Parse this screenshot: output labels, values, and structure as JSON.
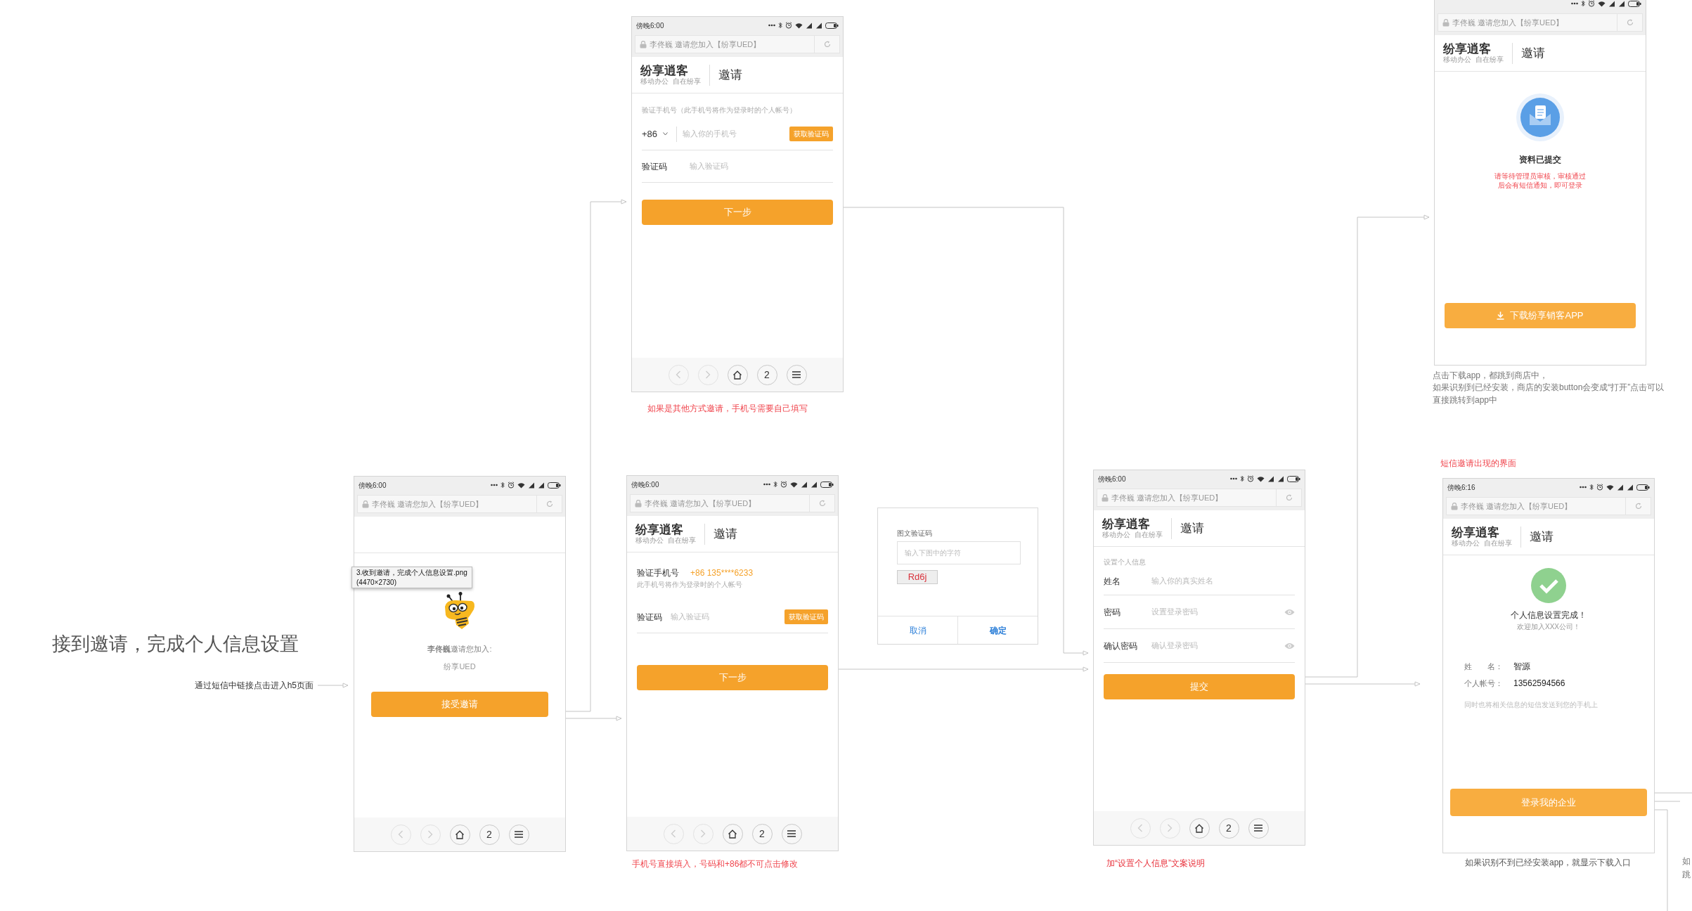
{
  "heading": "接到邀请，完成个人信息设置",
  "entry_note": "通过短信中链接点击进入h5页面",
  "screens": [
    {
      "kind": "phone_input",
      "status_time": "傍晚6:00",
      "address": "李佟巍 邀请您加入【纷享UED】",
      "logo": "纷享逍客",
      "tagline": "移动办公  自在纷享",
      "page_title": "邀请",
      "hint": "验证手机号（此手机号将作为登录时的个人帐号）",
      "country_code": "+86",
      "phone_placeholder": "输入你的手机号",
      "code_button": "获取验证码",
      "code_label": "验证码",
      "code_placeholder": "输入验证码",
      "submit": "下一步",
      "nav": [
        {
          "kind": "back",
          "disabled": true
        },
        {
          "kind": "forward",
          "disabled": true
        },
        {
          "kind": "home",
          "disabled": false
        },
        {
          "kind": "tabs",
          "label": "2",
          "disabled": false
        },
        {
          "kind": "menu",
          "disabled": false
        }
      ],
      "caption": {
        "lines": [
          "如果是其他方式邀请，手机号需要自己填写"
        ],
        "color": "#f0474f"
      }
    },
    {
      "kind": "invite",
      "status_time": "傍晚6:00",
      "address": "李佟巍 邀请您加入【纷享UED】",
      "tooltip": [
        "3.收到邀请，完成个人信息设置.png",
        "(4470×2730)"
      ],
      "inviter_line": "**李佟巍**邀请您加入:",
      "team": "纷享UED",
      "submit": "接受邀请",
      "nav": [
        {
          "kind": "back",
          "disabled": true
        },
        {
          "kind": "forward",
          "disabled": true
        },
        {
          "kind": "home",
          "disabled": false
        },
        {
          "kind": "tabs",
          "label": "2",
          "disabled": false
        },
        {
          "kind": "menu",
          "disabled": false
        }
      ]
    },
    {
      "kind": "phone_verified",
      "status_time": "傍晚6:00",
      "address": "李佟巍 邀请您加入【纷享UED】",
      "logo": "纷享逍客",
      "tagline": "移动办公  自在纷享",
      "page_title": "邀请",
      "phone_label": "验证手机号",
      "phone_value": "+86 135****6233",
      "hint": "此手机号将作为登录时的个人帐号",
      "code_label": "验证码",
      "code_placeholder": "输入验证码",
      "code_button": "获取验证码",
      "submit": "下一步",
      "nav": [
        {
          "kind": "back",
          "disabled": true
        },
        {
          "kind": "forward",
          "disabled": true
        },
        {
          "kind": "home",
          "disabled": false
        },
        {
          "kind": "tabs",
          "label": "2",
          "disabled": false
        },
        {
          "kind": "menu",
          "disabled": false
        }
      ],
      "caption": {
        "lines": [
          "手机号直接填入，号码和+86都不可点击修改"
        ],
        "color": "#f0474f"
      }
    },
    {
      "kind": "personal_info",
      "status_time": "傍晚6:00",
      "address": "李佟巍 邀请您加入【纷享UED】",
      "logo": "纷享逍客",
      "tagline": "移动办公  自在纷享",
      "page_title": "邀请",
      "section_label": "设置个人信息",
      "fields": [
        {
          "kind": "text",
          "label": "姓名",
          "placeholder": "输入你的真实姓名"
        },
        {
          "kind": "password",
          "label": "密码",
          "placeholder": "设置登录密码"
        },
        {
          "kind": "password",
          "label": "确认密码",
          "placeholder": "确认登录密码"
        }
      ],
      "submit": "提交",
      "nav": [
        {
          "kind": "back",
          "disabled": true
        },
        {
          "kind": "forward",
          "disabled": true
        },
        {
          "kind": "home",
          "disabled": false
        },
        {
          "kind": "tabs",
          "label": "2",
          "disabled": false
        },
        {
          "kind": "menu",
          "disabled": false
        }
      ],
      "caption": {
        "lines": [
          "加“设置个人信息”文案说明"
        ],
        "color": "#e8303a"
      }
    },
    {
      "kind": "submitted",
      "address": "李佟巍 邀请您加入【纷享UED】",
      "logo": "纷享逍客",
      "tagline": "移动办公  自在纷享",
      "page_title": "邀请",
      "title": "资料已提交",
      "message": [
        "请等待管理员审核，审核通过",
        "后会有短信通知，即可登录"
      ],
      "download": "下载纷享销客APP",
      "caption": {
        "lines": [
          "点击下载app，都跳到商店中，",
          "如果识别到已经安装，商店的安装button会变成“打开”点击可以",
          "直接跳转到app中"
        ],
        "color": "#777777"
      }
    },
    {
      "kind": "complete",
      "label": {
        "text": "短信邀请出现的界面",
        "color": "#f0474f"
      },
      "status_time": "傍晚6:16",
      "address": "李佟巍 邀请您加入【纷享UED】",
      "logo": "纷享逍客",
      "tagline": "移动办公  自在纷享",
      "page_title": "邀请",
      "title": "个人信息设置完成！",
      "subtitle": "欢迎加入XXX公司！",
      "details": [
        {
          "label": "姓　　名：",
          "value": "智源"
        },
        {
          "label": "个人帐号：",
          "value": "13562594566"
        }
      ],
      "note": "同时也将相关信息的短信发送到您的手机上",
      "submit": "登录我的企业",
      "caption": {
        "lines": [
          "如果识别不到已经安装app，就显示下载入口"
        ],
        "color": "#555555"
      }
    }
  ],
  "dialog": {
    "label": "图文验证码",
    "placeholder": "输入下图中的字符",
    "captcha": "Rd6j",
    "cancel": "取消",
    "confirm": "确定"
  },
  "edge_note": [
    "如",
    "跳"
  ]
}
